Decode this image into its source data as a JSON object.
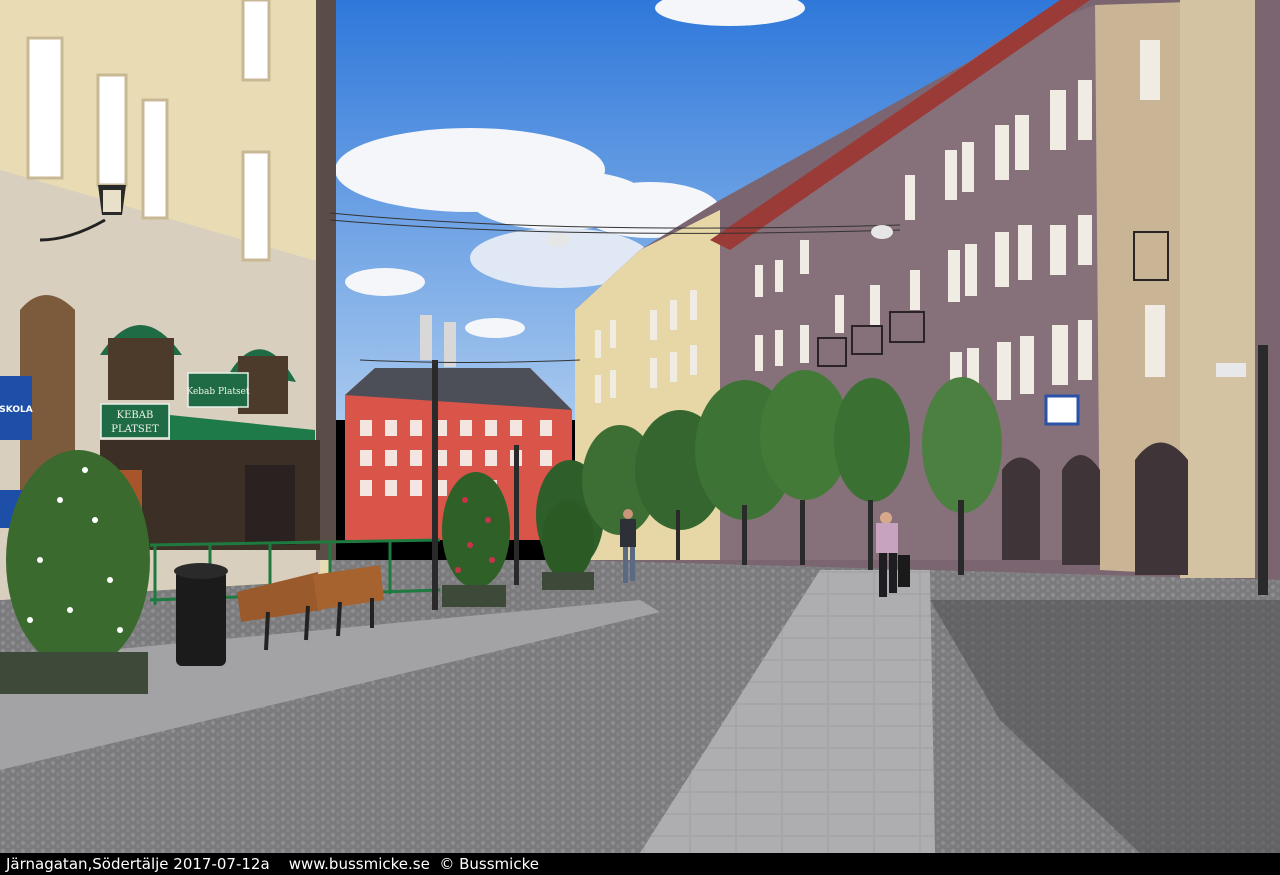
{
  "caption": "Järnagatan,Södertälje 2017-07-12a    www.bussmicke.se  © Bussmicke",
  "signs": {
    "kebab_sign_lower_line1": "KEBAB",
    "kebab_sign_lower_line2": "PLATSET",
    "kebab_sign_upper": "Kebab Platset",
    "left_blue_sign_text": "SKOLA"
  },
  "colors": {
    "sky": "#3f86dd",
    "red_building": "#d9554a",
    "awning_green": "#1f6b45",
    "purple_facade": "#7a6570",
    "cream_facade": "#e9dbb3"
  }
}
